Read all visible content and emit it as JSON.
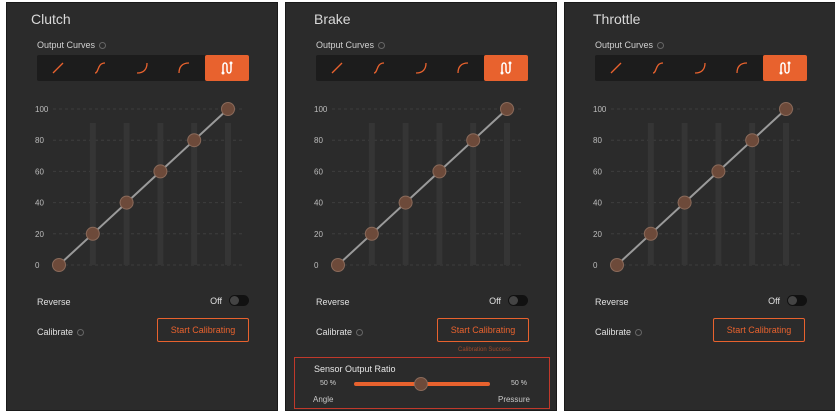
{
  "panels": [
    {
      "title": "Clutch",
      "output_curves_label": "Output Curves",
      "y_ticks": [
        "100",
        "80",
        "60",
        "40",
        "20",
        "0"
      ],
      "curve_points": [
        0,
        20,
        40,
        60,
        80,
        100
      ],
      "reverse_label": "Reverse",
      "reverse_state": "Off",
      "calibrate_label": "Calibrate",
      "calibrate_button": "Start Calibrating"
    },
    {
      "title": "Brake",
      "output_curves_label": "Output Curves",
      "y_ticks": [
        "100",
        "80",
        "60",
        "40",
        "20",
        "0"
      ],
      "curve_points": [
        0,
        20,
        40,
        60,
        80,
        100
      ],
      "reverse_label": "Reverse",
      "reverse_state": "Off",
      "calibrate_label": "Calibrate",
      "calibrate_button": "Start Calibrating",
      "calibration_hint": "Calibration Success",
      "sensor_output_ratio": {
        "label": "Sensor Output Ratio",
        "left_value": "50",
        "right_value": "50",
        "unit": "%",
        "left_label": "Angle",
        "right_label": "Pressure",
        "ratio": 0.5
      }
    },
    {
      "title": "Throttle",
      "output_curves_label": "Output Curves",
      "y_ticks": [
        "100",
        "80",
        "60",
        "40",
        "20",
        "0"
      ],
      "curve_points": [
        0,
        20,
        40,
        60,
        80,
        100
      ],
      "reverse_label": "Reverse",
      "reverse_state": "Off",
      "calibrate_label": "Calibrate",
      "calibrate_button": "Start Calibrating"
    }
  ],
  "curve_presets": [
    "linear-curve-icon",
    "s-curve-icon",
    "exponential-curve-icon",
    "log-curve-icon",
    "custom-curve-icon"
  ],
  "colors": {
    "accent": "#e8622e",
    "panel": "#2b2b2b",
    "node": "#6d4a3a",
    "highlight": "#c0392b"
  }
}
